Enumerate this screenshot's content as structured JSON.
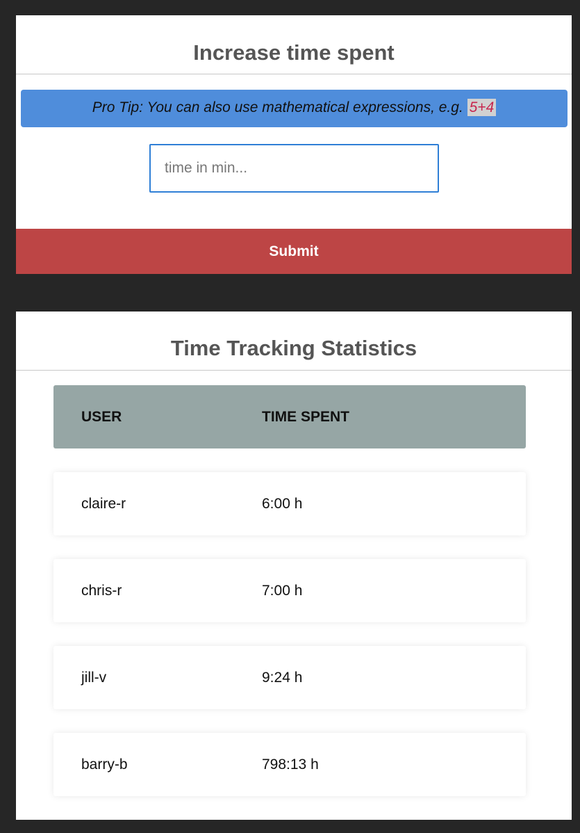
{
  "increase_panel": {
    "title": "Increase time spent",
    "pro_tip_text": "Pro Tip: You can also use mathematical expressions, e.g.",
    "pro_tip_example": "5+4",
    "input_placeholder": "time in min...",
    "input_value": "",
    "submit_label": "Submit"
  },
  "stats_panel": {
    "title": "Time Tracking Statistics",
    "columns": [
      "USER",
      "TIME SPENT"
    ],
    "rows": [
      {
        "user": "claire-r",
        "time": "6:00 h"
      },
      {
        "user": "chris-r",
        "time": "7:00 h"
      },
      {
        "user": "jill-v",
        "time": "9:24 h"
      },
      {
        "user": "barry-b",
        "time": "798:13 h"
      }
    ]
  },
  "colors": {
    "background": "#262626",
    "pro_tip_bg": "#4f8ddb",
    "submit_bg": "#bd4545",
    "table_header_bg": "#96a6a5",
    "input_border": "#2f7fd6",
    "code_text": "#c7254e"
  }
}
